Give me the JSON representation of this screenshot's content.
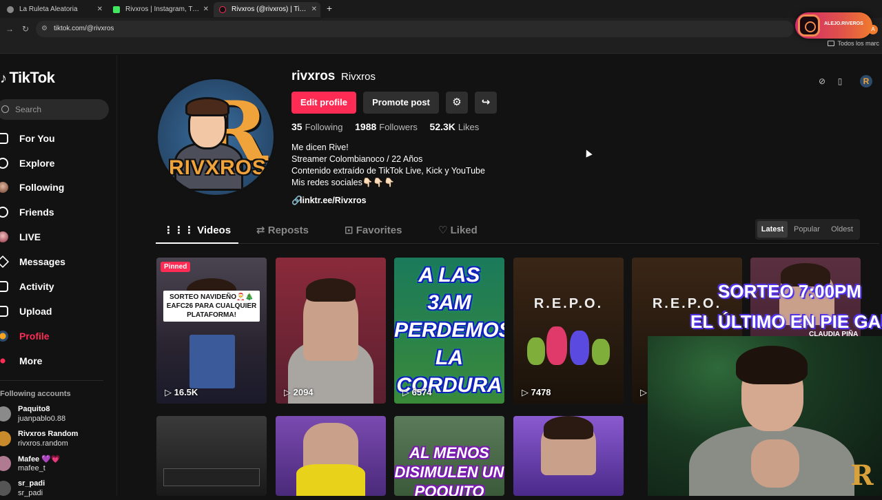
{
  "browser": {
    "tabs": [
      {
        "title": "La Ruleta Aleatoria",
        "close": "✕"
      },
      {
        "title": "Rivxros | Instagram, TikTok | Lin",
        "close": "✕"
      },
      {
        "title": "Rivxros (@rivxros) | TikTok",
        "close": "✕"
      }
    ],
    "new_tab": "+",
    "url": "tiktok.com/@rivxros",
    "bookmarks_label": "Todos los marc",
    "back": "←",
    "forward": "→",
    "reload": "↻"
  },
  "instagram_overlay": {
    "handle": "ALEJO.RIVEROS"
  },
  "sidebar": {
    "logo": "TikTok",
    "search_placeholder": "Search",
    "nav": [
      {
        "label": "For You",
        "icon": "home-icon"
      },
      {
        "label": "Explore",
        "icon": "compass-icon"
      },
      {
        "label": "Following",
        "icon": "following-avatar-icon"
      },
      {
        "label": "Friends",
        "icon": "friends-icon"
      },
      {
        "label": "LIVE",
        "icon": "live-avatar-icon"
      },
      {
        "label": "Messages",
        "icon": "send-icon"
      },
      {
        "label": "Activity",
        "icon": "bell-icon"
      },
      {
        "label": "Upload",
        "icon": "plus-square-icon"
      },
      {
        "label": "Profile",
        "icon": "profile-avatar-icon"
      },
      {
        "label": "More",
        "icon": "more-icon"
      }
    ],
    "following_title": "Following accounts",
    "following": [
      {
        "name": "Paquito8",
        "handle": "juanpablo0.88"
      },
      {
        "name": "Rivxros Random",
        "handle": "rivxros.random"
      },
      {
        "name": "Mafee 💜💗",
        "handle": "mafee_t"
      },
      {
        "name": "sr_padi",
        "handle": "sr_padi"
      }
    ]
  },
  "profile": {
    "username": "rivxros",
    "display_name": "Rivxros",
    "avatar_text": "RIVXROS",
    "avatar_letter": "R",
    "edit_label": "Edit profile",
    "promote_label": "Promote post",
    "stats": {
      "following_count": "35",
      "following_label": "Following",
      "followers_count": "1988",
      "followers_label": "Followers",
      "likes_count": "52.3K",
      "likes_label": "Likes"
    },
    "bio": [
      "Me dicen Rive!",
      "Streamer Colombianoco / 22 Años",
      "Contenido extraído de TikTok Live, Kick y YouTube",
      "Mis redes sociales👇🏻👇🏻👇🏻"
    ],
    "link": "linktr.ee/Rivxros"
  },
  "tabs": {
    "videos": "Videos",
    "reposts": "Reposts",
    "favorites": "Favorites",
    "liked": "Liked"
  },
  "sort": {
    "latest": "Latest",
    "popular": "Popular",
    "oldest": "Oldest"
  },
  "videos": [
    {
      "views": "16.5K",
      "pinned": "Pinned",
      "caption": "SORTEO NAVIDEÑO🎅🎄 EAFC26 PARA CUALQUIER PLATAFORMA!",
      "bg": "#3a3540"
    },
    {
      "views": "2094",
      "bg": "#6a2a3a"
    },
    {
      "views": "6574",
      "big_text": "A LAS 3AM PERDEMOS LA CORDURA",
      "bg": "#1f6a4a"
    },
    {
      "views": "7478",
      "repo": "R.E.P.O.",
      "bg": "#2a1a12"
    },
    {
      "views": "",
      "repo": "R.E.P.O.",
      "bg": "#2a1a12"
    },
    {
      "views": "",
      "bg": "#4a2a3a"
    }
  ],
  "videos_row2": [
    {
      "bg": "#2a2a2a"
    },
    {
      "bg": "#5a3a8a"
    },
    {
      "big_text": "AL MENOS DISIMULEN UN POQUITO",
      "bg": "#4a6a4a"
    },
    {
      "bg": "#6a4aa0"
    }
  ],
  "overlay": {
    "line1": "SORTEO 7:00PM",
    "line2": "EL ÚLTIMO EN PIE GANA",
    "line3": "CLAUDIA PIÑA"
  }
}
